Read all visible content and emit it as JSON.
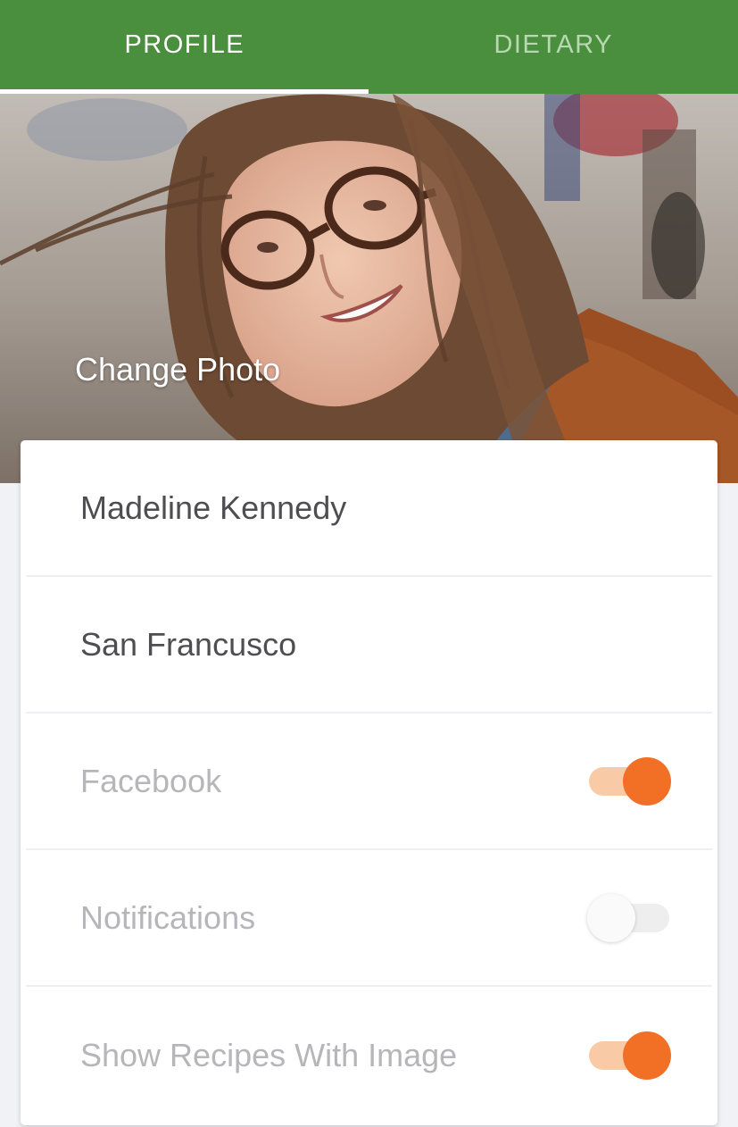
{
  "tabs": {
    "profile": "PROFILE",
    "dietary": "DIETARY",
    "active": "profile"
  },
  "photo": {
    "change_photo_label": "Change Photo"
  },
  "profile": {
    "name_value": "Madeline Kennedy",
    "city_value": "San Francusco"
  },
  "settings": [
    {
      "label": "Facebook",
      "enabled": true
    },
    {
      "label": "Notifications",
      "enabled": false
    },
    {
      "label": "Show Recipes With Image",
      "enabled": true
    }
  ],
  "colors": {
    "tabbar": "#4a8f3e",
    "accent": "#f26f26",
    "accent_light": "#f8cba6"
  }
}
